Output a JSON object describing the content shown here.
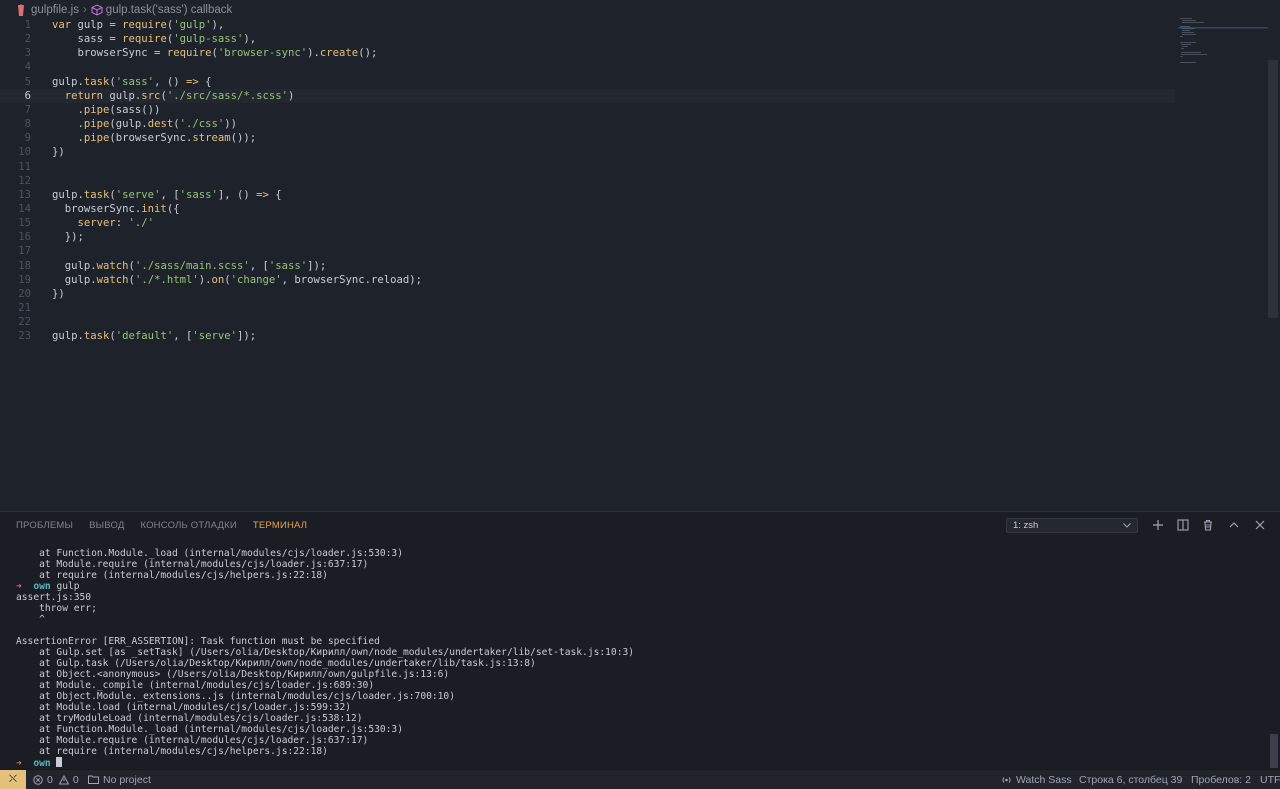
{
  "breadcrumb": {
    "file": "gulpfile.js",
    "symbol": "gulp.task('sass') callback"
  },
  "editor": {
    "lines": [
      {
        "n": "1",
        "tokens": [
          {
            "t": "var ",
            "c": "keyword"
          },
          {
            "t": "gulp = ",
            "c": "default"
          },
          {
            "t": "require",
            "c": "func"
          },
          {
            "t": "(",
            "c": "paren"
          },
          {
            "t": "'gulp'",
            "c": "string"
          },
          {
            "t": "),",
            "c": "default"
          }
        ]
      },
      {
        "n": "2",
        "tokens": [
          {
            "t": "    sass = ",
            "c": "default"
          },
          {
            "t": "require",
            "c": "func"
          },
          {
            "t": "(",
            "c": "paren"
          },
          {
            "t": "'gulp-sass'",
            "c": "string"
          },
          {
            "t": "),",
            "c": "default"
          }
        ]
      },
      {
        "n": "3",
        "tokens": [
          {
            "t": "    browserSync = ",
            "c": "default"
          },
          {
            "t": "require",
            "c": "func"
          },
          {
            "t": "(",
            "c": "paren"
          },
          {
            "t": "'browser-sync'",
            "c": "string"
          },
          {
            "t": ").",
            "c": "default"
          },
          {
            "t": "create",
            "c": "func"
          },
          {
            "t": "();",
            "c": "default"
          }
        ]
      },
      {
        "n": "4",
        "tokens": []
      },
      {
        "n": "5",
        "tokens": [
          {
            "t": "gulp.",
            "c": "default"
          },
          {
            "t": "task",
            "c": "func"
          },
          {
            "t": "(",
            "c": "paren"
          },
          {
            "t": "'sass'",
            "c": "string"
          },
          {
            "t": ", () ",
            "c": "default"
          },
          {
            "t": "=>",
            "c": "keyword"
          },
          {
            "t": " {",
            "c": "default"
          }
        ]
      },
      {
        "n": "6",
        "tokens": [
          {
            "t": "  return ",
            "c": "keyword"
          },
          {
            "t": "gulp.",
            "c": "default"
          },
          {
            "t": "src",
            "c": "func"
          },
          {
            "t": "(",
            "c": "paren"
          },
          {
            "t": "'./src/sass/*.scss'",
            "c": "string"
          },
          {
            "t": ")",
            "c": "default"
          }
        ]
      },
      {
        "n": "7",
        "tokens": [
          {
            "t": "    .",
            "c": "default"
          },
          {
            "t": "pipe",
            "c": "func"
          },
          {
            "t": "(sass())",
            "c": "default"
          }
        ]
      },
      {
        "n": "8",
        "tokens": [
          {
            "t": "    .",
            "c": "default"
          },
          {
            "t": "pipe",
            "c": "func"
          },
          {
            "t": "(gulp.",
            "c": "default"
          },
          {
            "t": "dest",
            "c": "func"
          },
          {
            "t": "(",
            "c": "paren"
          },
          {
            "t": "'./css'",
            "c": "string"
          },
          {
            "t": "))",
            "c": "default"
          }
        ]
      },
      {
        "n": "9",
        "tokens": [
          {
            "t": "    .",
            "c": "default"
          },
          {
            "t": "pipe",
            "c": "func"
          },
          {
            "t": "(browserSync.",
            "c": "default"
          },
          {
            "t": "stream",
            "c": "func"
          },
          {
            "t": "());",
            "c": "default"
          }
        ]
      },
      {
        "n": "10",
        "tokens": [
          {
            "t": "})",
            "c": "default"
          }
        ]
      },
      {
        "n": "11",
        "tokens": []
      },
      {
        "n": "12",
        "tokens": []
      },
      {
        "n": "13",
        "tokens": [
          {
            "t": "gulp.",
            "c": "default"
          },
          {
            "t": "task",
            "c": "func"
          },
          {
            "t": "(",
            "c": "paren"
          },
          {
            "t": "'serve'",
            "c": "string"
          },
          {
            "t": ", [",
            "c": "default"
          },
          {
            "t": "'sass'",
            "c": "string"
          },
          {
            "t": "], () ",
            "c": "default"
          },
          {
            "t": "=>",
            "c": "keyword"
          },
          {
            "t": " {",
            "c": "default"
          }
        ]
      },
      {
        "n": "14",
        "tokens": [
          {
            "t": "  browserSync.",
            "c": "default"
          },
          {
            "t": "init",
            "c": "func"
          },
          {
            "t": "({",
            "c": "default"
          }
        ]
      },
      {
        "n": "15",
        "tokens": [
          {
            "t": "    server",
            "c": "keyword"
          },
          {
            "t": ": ",
            "c": "default"
          },
          {
            "t": "'./'",
            "c": "string"
          }
        ]
      },
      {
        "n": "16",
        "tokens": [
          {
            "t": "  });",
            "c": "default"
          }
        ]
      },
      {
        "n": "17",
        "tokens": []
      },
      {
        "n": "18",
        "tokens": [
          {
            "t": "  gulp.",
            "c": "default"
          },
          {
            "t": "watch",
            "c": "func"
          },
          {
            "t": "(",
            "c": "paren"
          },
          {
            "t": "'./sass/main.scss'",
            "c": "string"
          },
          {
            "t": ", [",
            "c": "default"
          },
          {
            "t": "'sass'",
            "c": "string"
          },
          {
            "t": "]);",
            "c": "default"
          }
        ]
      },
      {
        "n": "19",
        "tokens": [
          {
            "t": "  gulp.",
            "c": "default"
          },
          {
            "t": "watch",
            "c": "func"
          },
          {
            "t": "(",
            "c": "paren"
          },
          {
            "t": "'./*.html'",
            "c": "string"
          },
          {
            "t": ").",
            "c": "default"
          },
          {
            "t": "on",
            "c": "func"
          },
          {
            "t": "(",
            "c": "paren"
          },
          {
            "t": "'change'",
            "c": "string"
          },
          {
            "t": ", browserSync.reload);",
            "c": "default"
          }
        ]
      },
      {
        "n": "20",
        "tokens": [
          {
            "t": "})",
            "c": "default"
          }
        ]
      },
      {
        "n": "21",
        "tokens": []
      },
      {
        "n": "22",
        "tokens": []
      },
      {
        "n": "23",
        "tokens": [
          {
            "t": "gulp.",
            "c": "default"
          },
          {
            "t": "task",
            "c": "func"
          },
          {
            "t": "(",
            "c": "paren"
          },
          {
            "t": "'default'",
            "c": "string"
          },
          {
            "t": ", [",
            "c": "default"
          },
          {
            "t": "'serve'",
            "c": "string"
          },
          {
            "t": "]);",
            "c": "default"
          }
        ]
      }
    ]
  },
  "panel": {
    "tabs": [
      {
        "label": "ПРОБЛЕМЫ",
        "active": false
      },
      {
        "label": "ВЫВОД",
        "active": false
      },
      {
        "label": "КОНСОЛЬ ОТЛАДКИ",
        "active": false
      },
      {
        "label": "ТЕРМИНАЛ",
        "active": true
      }
    ],
    "terminal_select": "1: zsh"
  },
  "terminal": {
    "lines": [
      {
        "text": "    at Function.Module._load (internal/modules/cjs/loader.js:530:3)"
      },
      {
        "text": "    at Module.require (internal/modules/cjs/loader.js:637:17)"
      },
      {
        "text": "    at require (internal/modules/cjs/helpers.js:22:18)"
      },
      {
        "prompt": true,
        "dir": "own",
        "text": " gulp"
      },
      {
        "text": "assert.js:350"
      },
      {
        "text": "    throw err;"
      },
      {
        "text": "    ^"
      },
      {
        "text": ""
      },
      {
        "text": "AssertionError [ERR_ASSERTION]: Task function must be specified"
      },
      {
        "text": "    at Gulp.set [as _setTask] (/Users/olia/Desktop/Кирилл/own/node_modules/undertaker/lib/set-task.js:10:3)"
      },
      {
        "text": "    at Gulp.task (/Users/olia/Desktop/Кирилл/own/node_modules/undertaker/lib/task.js:13:8)"
      },
      {
        "text": "    at Object.<anonymous> (/Users/olia/Desktop/Кирилл/own/gulpfile.js:13:6)"
      },
      {
        "text": "    at Module._compile (internal/modules/cjs/loader.js:689:30)"
      },
      {
        "text": "    at Object.Module._extensions..js (internal/modules/cjs/loader.js:700:10)"
      },
      {
        "text": "    at Module.load (internal/modules/cjs/loader.js:599:32)"
      },
      {
        "text": "    at tryModuleLoad (internal/modules/cjs/loader.js:538:12)"
      },
      {
        "text": "    at Function.Module._load (internal/modules/cjs/loader.js:530:3)"
      },
      {
        "text": "    at Module.require (internal/modules/cjs/loader.js:637:17)"
      },
      {
        "text": "    at require (internal/modules/cjs/helpers.js:22:18)"
      },
      {
        "prompt": true,
        "dir": "own",
        "text": " ",
        "cursor": true
      }
    ],
    "prompt_symbol": "➜"
  },
  "statusbar": {
    "remote_icon": "⛌",
    "errors": "0",
    "warnings": "0",
    "project": "No project",
    "watch": "Watch Sass",
    "position": "Строка 6, столбец 39",
    "spaces": "Пробелов: 2",
    "encoding": "UTF"
  },
  "colors": {
    "accent": "#e5a452",
    "remote": "#e5c07b",
    "string": "#98c379",
    "prompt_arrow": "#e06c75",
    "prompt_dir": "#56b6c2"
  }
}
